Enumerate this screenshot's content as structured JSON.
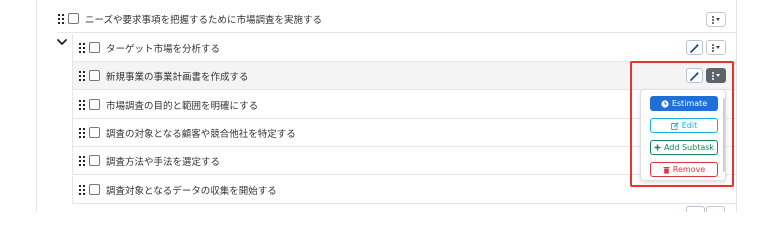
{
  "tasks": [
    {
      "label": "ニーズや要求事項を把握するために市場調査を実施する"
    },
    {
      "label": "ターゲット市場を分析する"
    },
    {
      "label": "新規事業の事業計画書を作成する"
    },
    {
      "label": "市場調査の目的と範囲を明確にする"
    },
    {
      "label": "調査の対象となる顧客や競合他社を特定する"
    },
    {
      "label": "調査方法や手法を選定する"
    },
    {
      "label": "調査対象となるデータの収集を開始する"
    }
  ],
  "dropdown": {
    "estimate_label": "Estimate",
    "edit_label": "Edit",
    "add_subtask_label": "Add Subtask",
    "remove_label": "Remove"
  },
  "icons": {
    "drag": "drag-handle-icon",
    "checkbox": "checkbox-icon",
    "chevron": "chevron-down-icon",
    "wand": "magic-wand-icon",
    "kebab": "more-options-icon",
    "estimate": "clock-icon",
    "edit": "edit-icon",
    "add": "plus-icon",
    "remove": "trash-icon"
  },
  "colors": {
    "estimate": "#1f6fd8",
    "edit": "#1bb0d6",
    "add": "#198754",
    "remove": "#dc3545",
    "highlight": "#e8342a",
    "active_button": "#5c636a"
  }
}
